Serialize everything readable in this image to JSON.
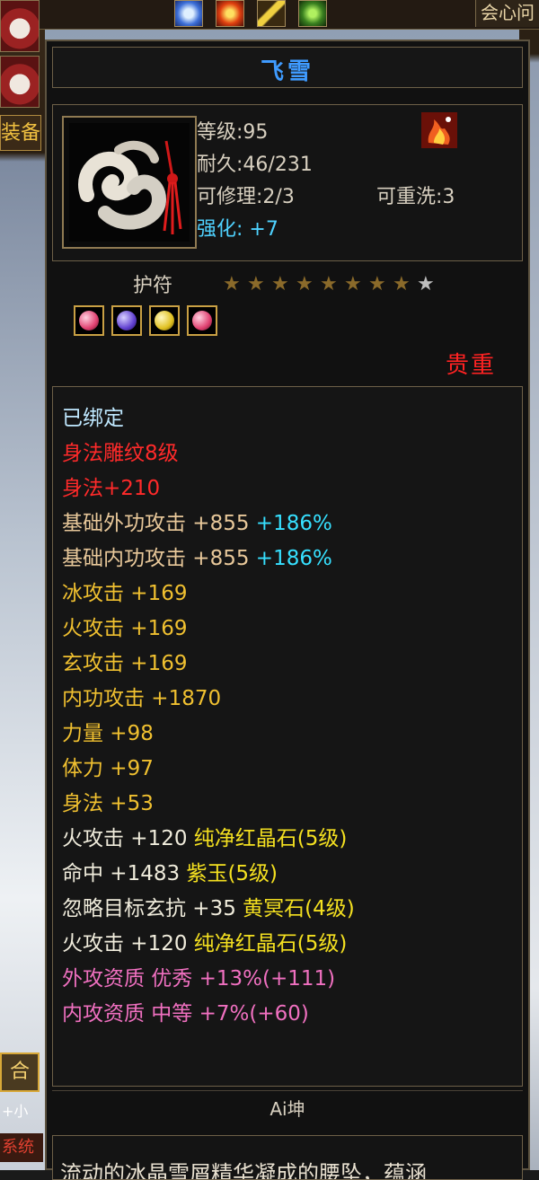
{
  "top_bar": {
    "right_label": "会心问",
    "skill_icons": [
      "skill-blue-icon",
      "skill-fire-icon",
      "skill-lightning-icon",
      "skill-green-icon"
    ]
  },
  "left_panel": {
    "tab_label": "装备",
    "button_label": "合",
    "small_text": "+小",
    "red_text": "系统"
  },
  "item": {
    "name": "飞雪",
    "level": "等级:95",
    "durability": "耐久:46/231",
    "repairable": "可修理:2/3",
    "rewashable": "可重洗:3",
    "enhance": "强化: +7",
    "type": "护符",
    "stars_total": 9,
    "stars_filled": 8,
    "rarity": "贵重",
    "gems": [
      "pink-gem-icon",
      "purple-gem-icon",
      "yellow-gem-icon",
      "pink-gem-icon"
    ]
  },
  "attributes": [
    {
      "text": "已绑定",
      "color": "bound"
    },
    {
      "text": "身法雕纹8级",
      "color": "red"
    },
    {
      "text": "身法+210",
      "color": "red"
    },
    {
      "text": "基础外功攻击 +855",
      "extra": "+186%",
      "color": "tan"
    },
    {
      "text": "基础内功攻击 +855",
      "extra": "+186%",
      "color": "tan"
    },
    {
      "text": "冰攻击 +169",
      "color": "gold"
    },
    {
      "text": "火攻击 +169",
      "color": "gold"
    },
    {
      "text": "玄攻击 +169",
      "color": "gold"
    },
    {
      "text": "内功攻击 +1870",
      "color": "gold"
    },
    {
      "text": "力量 +98",
      "color": "gold"
    },
    {
      "text": "体力 +97",
      "color": "gold"
    },
    {
      "text": "身法 +53",
      "color": "gold"
    },
    {
      "text": "火攻击 +120",
      "extra": "纯净红晶石(5级)",
      "color": "white"
    },
    {
      "text": "命中 +1483",
      "extra": "紫玉(5级)",
      "color": "white"
    },
    {
      "text": "忽略目标玄抗 +35",
      "extra": "黄冥石(4级)",
      "color": "white"
    },
    {
      "text": "火攻击 +120",
      "extra": "纯净红晶石(5级)",
      "color": "white"
    },
    {
      "text": "外攻资质  优秀 +13%(+111)",
      "color": "pink"
    },
    {
      "text": "内攻资质  中等 +7%(+60)",
      "color": "pink"
    }
  ],
  "owner": "Ai坤",
  "description": "流动的冰晶雪屑精华凝成的腰坠，蕴涵"
}
